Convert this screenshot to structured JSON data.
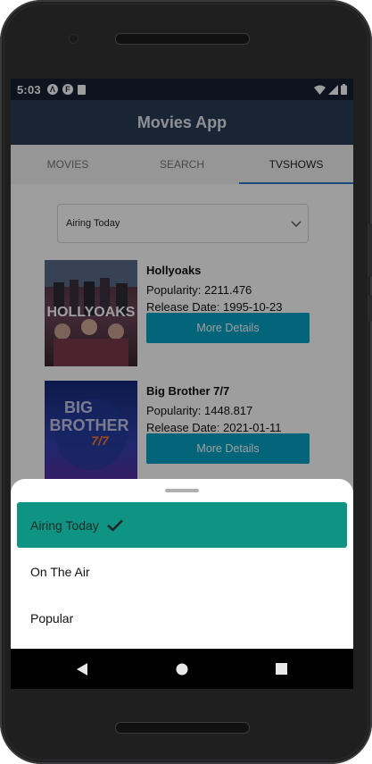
{
  "status_bar": {
    "time": "5:03",
    "left_icons": [
      "accessibility-icon",
      "f-app-icon",
      "sd-card-icon"
    ],
    "right_icons": [
      "wifi-icon",
      "signal-icon",
      "battery-icon"
    ]
  },
  "app": {
    "title": "Movies App",
    "primary_color": "#293a54",
    "accent_color": "#07a3c5"
  },
  "tabs": [
    {
      "label": "MOVIES",
      "active": false
    },
    {
      "label": "SEARCH",
      "active": false
    },
    {
      "label": "TVSHOWS",
      "active": true
    }
  ],
  "dropdown": {
    "selected": "Airing Today"
  },
  "shows": [
    {
      "title": "Hollyoaks",
      "popularity": "Popularity: 2211.476",
      "release": "Release Date: 1995-10-23",
      "button": "More Details",
      "poster_text": "HOLLYOAKS"
    },
    {
      "title": "Big Brother 7/7",
      "popularity": "Popularity: 1448.817",
      "release": "Release Date: 2021-01-11",
      "button": "More Details",
      "poster_text_1": "BIG",
      "poster_text_2": "BROTHER",
      "poster_text_3": "7/7"
    }
  ],
  "sheet": {
    "options": [
      {
        "label": "Airing Today",
        "selected": true
      },
      {
        "label": "On The Air",
        "selected": false
      },
      {
        "label": "Popular",
        "selected": false
      }
    ],
    "selected_color": "#0f9383"
  },
  "nav": {
    "buttons": [
      "back-icon",
      "home-icon",
      "recents-icon"
    ]
  }
}
